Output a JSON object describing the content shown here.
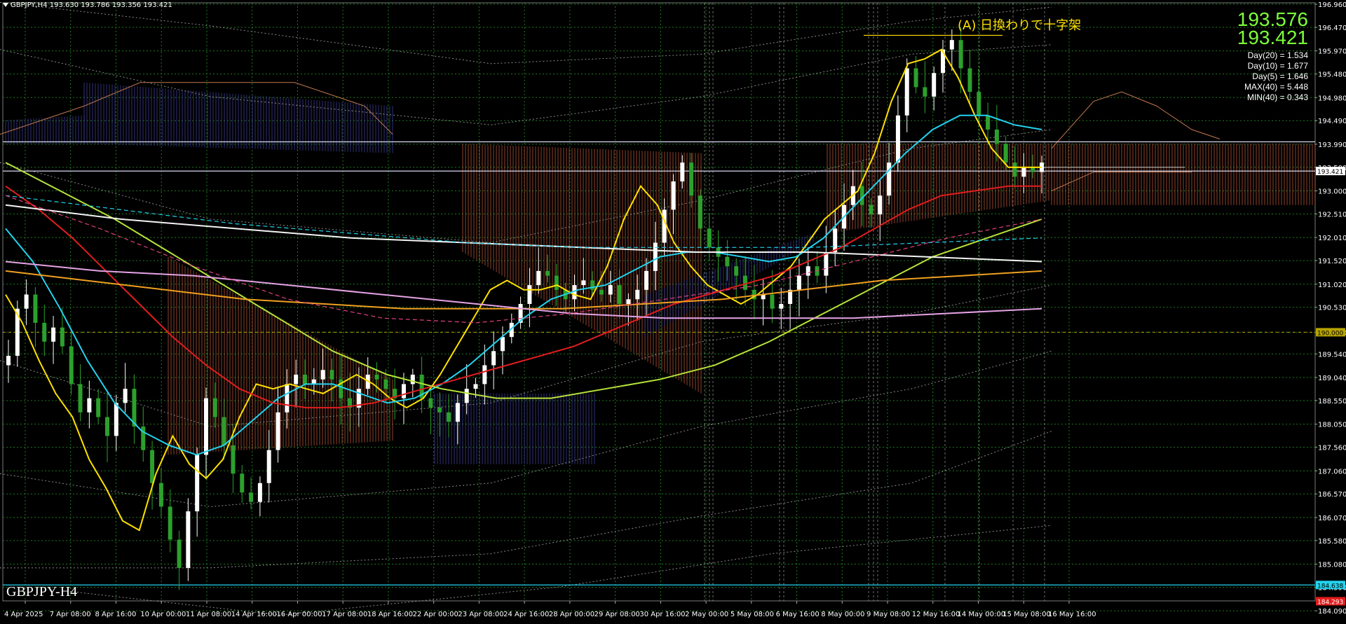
{
  "header": {
    "symbol_line": "GBPJPY,H4  193.630 193.786 193.356 193.421"
  },
  "overlay": {
    "bid": "193.576",
    "ask": "193.421",
    "stats": [
      "Day(20) = 1.534",
      "Day(10) = 1.677",
      "Day(5) = 1.646",
      "MAX(40) = 5.448",
      "MIN(40) = 0.343"
    ],
    "annotation": "(A) 日換わりで十字架",
    "symbol_label": "GBPJPY-H4"
  },
  "colors": {
    "background": "#000000",
    "grid": "#1f7a1f",
    "bull": "#ffffff",
    "bear": "#2ca02c",
    "ma_fast": "#ffe100",
    "ma_mid": "#22d3ee",
    "ma_slow": "#e11d1d",
    "ma_long": "#b7e33a",
    "ma_orange": "#f0a020",
    "ma_pink": "#e6a3e6",
    "cloud_bear": "#c0583a",
    "cloud_bull": "#4040a0",
    "hline_cyan": "#22d3ee"
  },
  "chart_data": {
    "type": "candlestick",
    "ylim": [
      184.3,
      196.99
    ],
    "y_ticks": [
      "196.960",
      "196.470",
      "195.970",
      "195.480",
      "194.980",
      "194.490",
      "193.990",
      "193.500",
      "193.000",
      "192.510",
      "192.010",
      "191.520",
      "191.020",
      "190.530",
      "190.000",
      "189.540",
      "189.040",
      "188.550",
      "188.050",
      "187.560",
      "187.060",
      "186.570",
      "186.070",
      "185.580",
      "185.080",
      "184.590",
      "184.090"
    ],
    "x_labels": [
      "4 Apr 2025",
      "7 Apr 08:00",
      "8 Apr 16:00",
      "10 Apr 00:00",
      "11 Apr 08:00",
      "14 Apr 16:00",
      "16 Apr 00:00",
      "17 Apr 08:00",
      "18 Apr 16:00",
      "22 Apr 00:00",
      "23 Apr 08:00",
      "24 Apr 16:00",
      "28 Apr 00:00",
      "29 Apr 08:00",
      "30 Apr 16:00",
      "2 May 00:00",
      "5 May 08:00",
      "6 May 16:00",
      "8 May 00:00",
      "9 May 08:00",
      "12 May 16:00",
      "14 May 00:00",
      "15 May 08:00",
      "16 May 16:00"
    ],
    "price_tags": [
      {
        "value": 193.421,
        "label": "193.421",
        "bg": "#ffffff",
        "fg": "#000000"
      },
      {
        "value": 190.0,
        "label": "190.000",
        "bg": "#b8a400",
        "fg": "#000000"
      },
      {
        "value": 184.638,
        "label": "184.638",
        "bg": "#22d3ee",
        "fg": "#000000"
      },
      {
        "value": 184.293,
        "label": "184.293",
        "bg": "#e11d1d",
        "fg": "#ffffff"
      }
    ],
    "hlines": [
      {
        "value": 194.04,
        "color": "#d8d8f0"
      },
      {
        "value": 193.42,
        "color": "#d8d8f0"
      },
      {
        "value": 184.638,
        "color": "#22d3ee"
      }
    ],
    "close_path": [
      189.5,
      190.5,
      190.8,
      190.2,
      189.8,
      190.1,
      189.7,
      188.9,
      188.3,
      188.6,
      188.2,
      187.8,
      188.5,
      188.8,
      188.0,
      187.5,
      186.8,
      186.3,
      185.6,
      185.0,
      186.2,
      187.4,
      188.6,
      188.2,
      187.6,
      187.0,
      186.6,
      186.4,
      186.8,
      187.5,
      188.3,
      188.9,
      189.1,
      188.9,
      189.0,
      189.2,
      189.0,
      188.6,
      188.4,
      188.8,
      189.1,
      189.0,
      188.8,
      188.6,
      188.9,
      189.1,
      188.6,
      188.4,
      188.3,
      188.1,
      188.5,
      188.8,
      188.9,
      189.3,
      189.6,
      189.9,
      190.2,
      190.6,
      191.0,
      191.3,
      191.2,
      190.9,
      190.7,
      191.0,
      191.1,
      190.9,
      190.8,
      191.0,
      190.6,
      190.7,
      190.9,
      191.3,
      191.9,
      192.6,
      193.2,
      193.6,
      192.9,
      192.2,
      191.8,
      191.6,
      191.4,
      191.2,
      190.9,
      190.7,
      190.8,
      190.5,
      190.6,
      190.9,
      191.2,
      191.4,
      191.2,
      191.7,
      192.2,
      192.7,
      193.1,
      192.7,
      192.5,
      192.9,
      193.6,
      194.6,
      195.6,
      195.2,
      195.0,
      195.5,
      196.0,
      196.2,
      195.6,
      195.1,
      194.6,
      194.3,
      194.0,
      193.6,
      193.3,
      193.5,
      193.4,
      193.6
    ],
    "ma_fast": [
      190.8,
      190.2,
      189.4,
      188.7,
      188.2,
      187.3,
      186.7,
      186.0,
      185.8,
      187.0,
      187.8,
      187.2,
      186.9,
      187.3,
      188.2,
      188.9,
      188.8,
      188.9,
      188.8,
      188.7,
      188.9,
      189.1,
      188.9,
      188.6,
      188.4,
      188.6,
      189.1,
      189.7,
      190.3,
      190.9,
      191.1,
      190.9,
      190.9,
      191.0,
      190.8,
      190.7,
      191.4,
      192.4,
      193.1,
      192.7,
      191.9,
      191.4,
      191.0,
      190.8,
      190.6,
      190.8,
      191.1,
      191.4,
      191.9,
      192.4,
      192.7,
      193.0,
      193.8,
      194.9,
      195.7,
      195.8,
      196.0,
      195.4,
      194.6,
      193.9,
      193.5,
      193.5,
      193.5
    ],
    "ma_mid": [
      192.2,
      191.5,
      190.5,
      189.4,
      188.5,
      187.9,
      187.6,
      187.4,
      187.6,
      188.1,
      188.6,
      188.9,
      188.9,
      188.7,
      188.5,
      188.6,
      188.9,
      189.3,
      189.8,
      190.3,
      190.7,
      190.9,
      191.0,
      191.3,
      191.6,
      191.7,
      191.7,
      191.6,
      191.5,
      191.6,
      192.0,
      192.6,
      193.2,
      193.8,
      194.3,
      194.6,
      194.6,
      194.4,
      194.3
    ],
    "ma_slow": [
      193.1,
      192.6,
      192.0,
      191.3,
      190.6,
      189.9,
      189.3,
      188.8,
      188.5,
      188.4,
      188.4,
      188.5,
      188.7,
      188.9,
      189.1,
      189.3,
      189.5,
      189.7,
      190.0,
      190.3,
      190.6,
      190.8,
      191.0,
      191.2,
      191.5,
      191.8,
      192.2,
      192.6,
      192.9,
      193.0,
      193.1,
      193.1
    ]
  }
}
